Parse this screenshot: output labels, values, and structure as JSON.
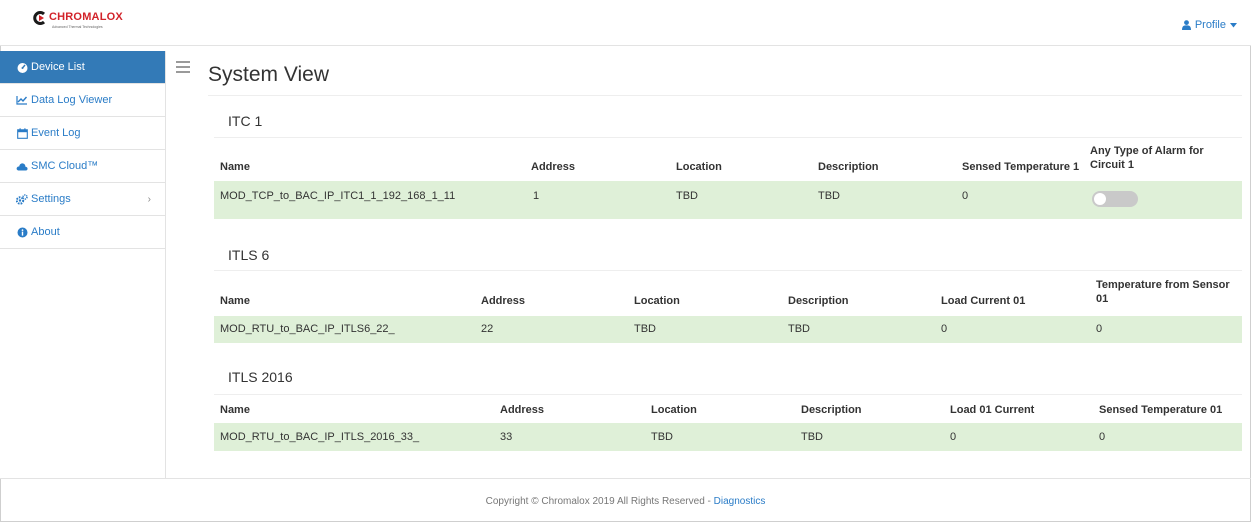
{
  "header": {
    "logo_text": "CHROMALOX",
    "logo_tagline": "Advanced Thermal Technologies",
    "profile_label": "Profile"
  },
  "sidebar": {
    "items": [
      {
        "label": "Device List",
        "icon": "dashboard-icon",
        "active": true
      },
      {
        "label": "Data Log Viewer",
        "icon": "line-chart-icon"
      },
      {
        "label": "Event Log",
        "icon": "calendar-icon"
      },
      {
        "label": "SMC Cloud™",
        "icon": "cloud-icon"
      },
      {
        "label": "Settings",
        "icon": "gears-icon",
        "has_submenu": true
      },
      {
        "label": "About",
        "icon": "info-icon"
      }
    ]
  },
  "main": {
    "title": "System View",
    "sections": [
      {
        "title": "ITC 1",
        "headers": [
          "Name",
          "Address",
          "Location",
          "Description",
          "Sensed Temperature 1",
          "Any Type of Alarm for Circuit 1"
        ],
        "row": [
          "MOD_TCP_to_BAC_IP_ITC1_1_192_168_1_11",
          "1",
          "TBD",
          "TBD",
          "0"
        ],
        "alarm_toggle_on": false
      },
      {
        "title": "ITLS 6",
        "headers": [
          "Name",
          "Address",
          "Location",
          "Description",
          "Load Current 01",
          "Temperature from Sensor 01"
        ],
        "row": [
          "MOD_RTU_to_BAC_IP_ITLS6_22_",
          "22",
          "TBD",
          "TBD",
          "0",
          "0"
        ]
      },
      {
        "title": "ITLS 2016",
        "headers": [
          "Name",
          "Address",
          "Location",
          "Description",
          "Load 01 Current",
          "Sensed Temperature 01"
        ],
        "row": [
          "MOD_RTU_to_BAC_IP_ITLS_2016_33_",
          "33",
          "TBD",
          "TBD",
          "0",
          "0"
        ]
      }
    ]
  },
  "footer": {
    "copyright": "Copyright © Chromalox 2019 All Rights Reserved - ",
    "diagnostics_link": "Diagnostics"
  },
  "colors": {
    "accent": "#337ab7",
    "link": "#2a7cc7",
    "row_highlight": "#dff0d8",
    "brand_red": "#d2232a"
  }
}
